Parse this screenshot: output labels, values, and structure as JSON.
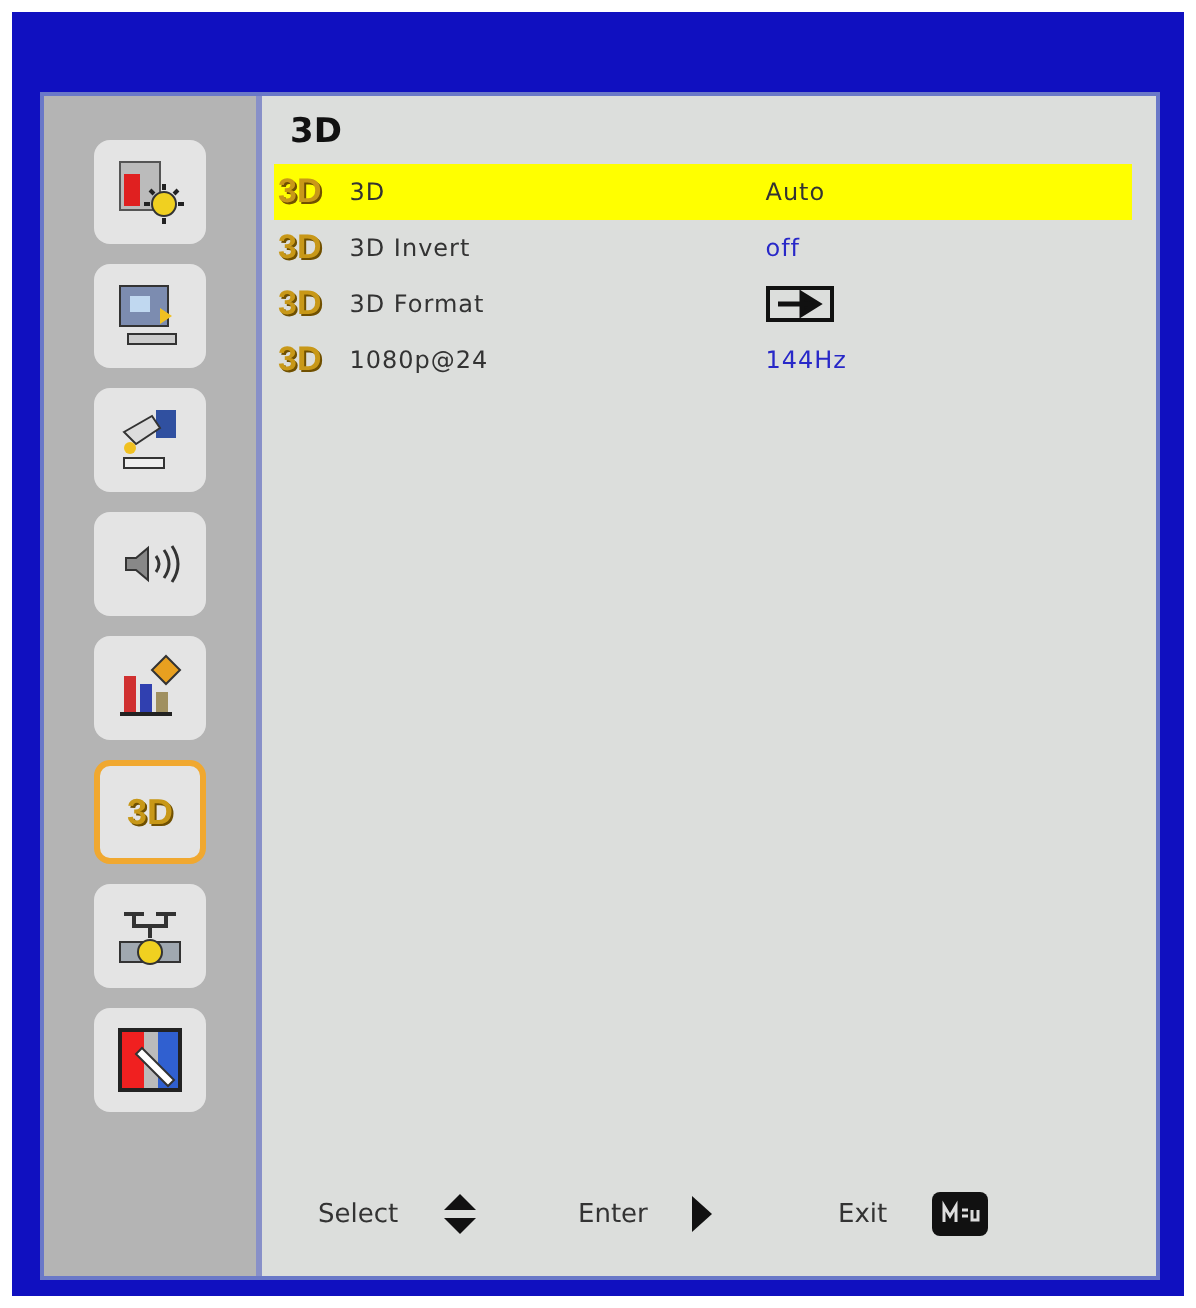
{
  "sidebar": {
    "items": [
      {
        "kind": "image",
        "selected": false
      },
      {
        "kind": "display",
        "selected": false
      },
      {
        "kind": "setup",
        "selected": false
      },
      {
        "kind": "audio",
        "selected": false
      },
      {
        "kind": "options",
        "selected": false
      },
      {
        "kind": "text",
        "label": "3D",
        "selected": true
      },
      {
        "kind": "network",
        "selected": false
      },
      {
        "kind": "interactive",
        "selected": false
      }
    ]
  },
  "panel": {
    "title": "3D",
    "rows": [
      {
        "badge": "3D",
        "label": "3D",
        "value": "Auto",
        "kind": "text",
        "selected": true
      },
      {
        "badge": "3D",
        "label": "3D Invert",
        "value": "off",
        "kind": "text",
        "selected": false
      },
      {
        "badge": "3D",
        "label": "3D Format",
        "kind": "arrow",
        "selected": false
      },
      {
        "badge": "3D",
        "label": "1080p@24",
        "value": "144Hz",
        "kind": "text",
        "selected": false
      }
    ]
  },
  "footer": [
    {
      "label": "Select",
      "kind": "updown"
    },
    {
      "label": "Enter",
      "kind": "right"
    },
    {
      "label": "Exit",
      "kind": "menu"
    }
  ]
}
